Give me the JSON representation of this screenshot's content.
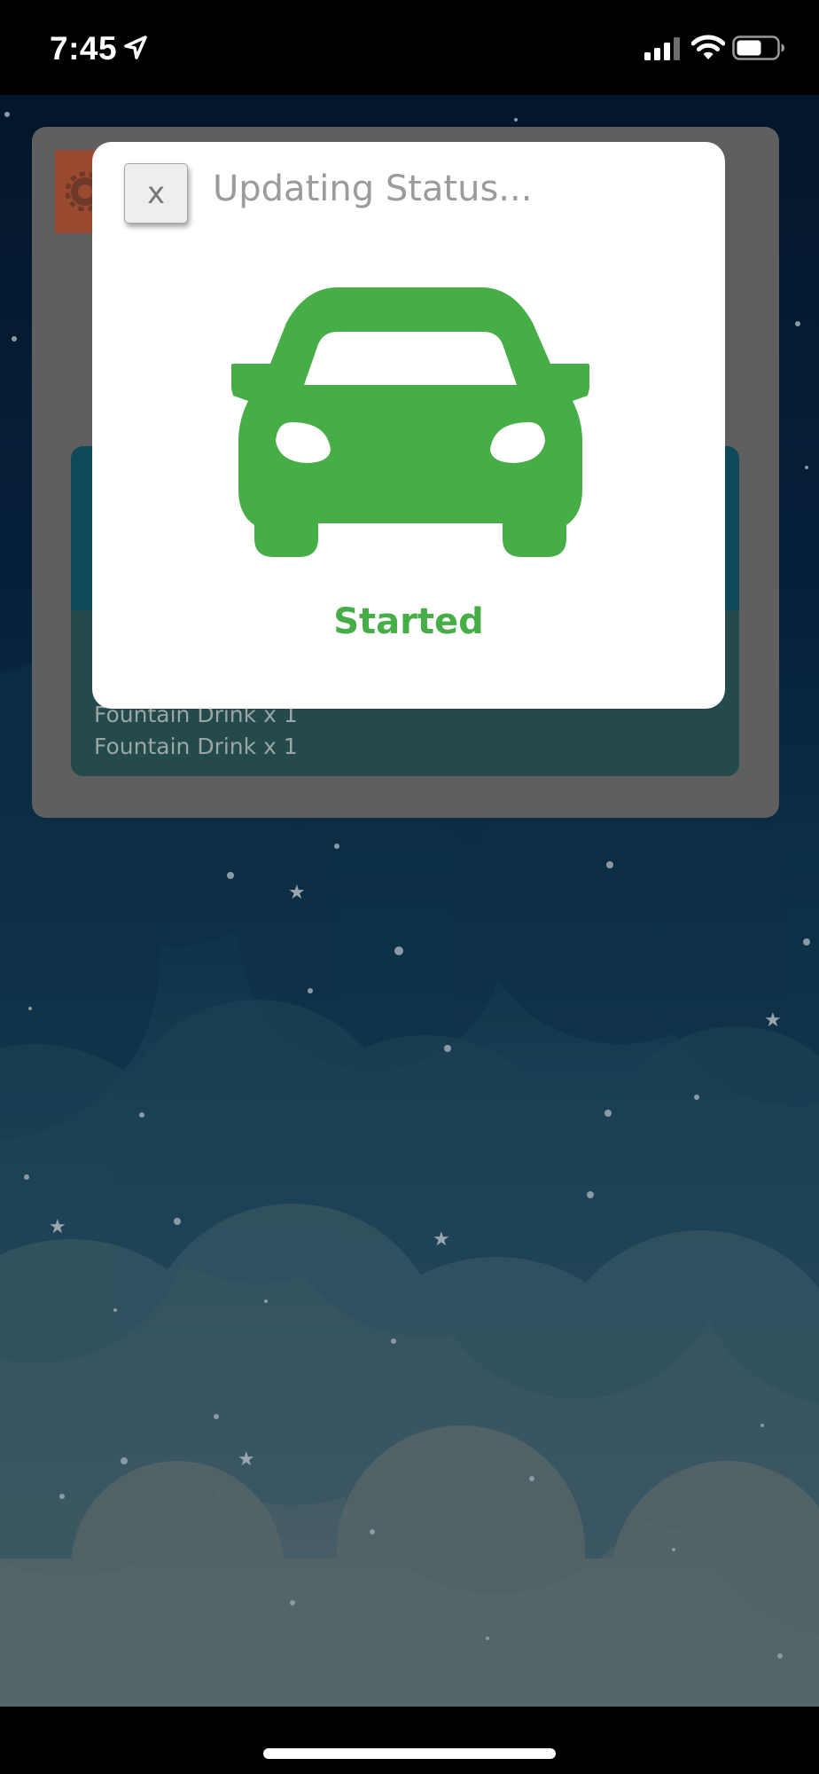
{
  "status_bar": {
    "time": "7:45",
    "icons": [
      "location-arrow-icon",
      "cellular-signal-icon",
      "wifi-icon",
      "battery-icon"
    ]
  },
  "order": {
    "items": [
      "Fountain Drink x 1",
      "Fountain Drink x 1"
    ]
  },
  "modal": {
    "close_label": "x",
    "title": "Updating Status...",
    "icon": "car-icon",
    "status": "Started",
    "status_color": "#46ad47"
  },
  "colors": {
    "sky_top": "#03162a",
    "sky_bottom": "#566568",
    "accent_green": "#46ad47",
    "settings_button": "#9a4a30"
  }
}
